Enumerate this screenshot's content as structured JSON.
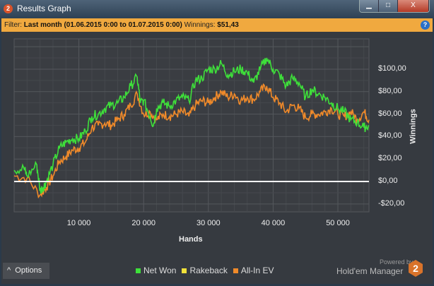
{
  "window": {
    "title": "Results Graph",
    "app_icon": "2",
    "minimize": "▁",
    "maximize": "□",
    "close": "X"
  },
  "filter": {
    "label": "Filter:",
    "value": "Last month (01.06.2015 0:00 to 01.07.2015 0:00)",
    "winnings_label": "Winnings:",
    "winnings_value": "$51,43",
    "help": "?"
  },
  "options_label": "Options",
  "options_chevron": "^",
  "branding": {
    "powered": "Powered by",
    "name": "Hold'em Manager",
    "logo": "2"
  },
  "colors": {
    "net_won": "#3ee03a",
    "rakeback": "#f2e23a",
    "all_in_ev": "#f08a2a"
  },
  "chart_data": {
    "type": "line",
    "xlabel": "Hands",
    "ylabel": "Winnings",
    "xlim": [
      0,
      54800
    ],
    "ylim": [
      -27,
      127
    ],
    "x_ticks": [
      {
        "v": 10000,
        "label": "10 000"
      },
      {
        "v": 20000,
        "label": "20 000"
      },
      {
        "v": 30000,
        "label": "30 000"
      },
      {
        "v": 40000,
        "label": "40 000"
      },
      {
        "v": 50000,
        "label": "50 000"
      }
    ],
    "y_ticks": [
      {
        "v": 100,
        "label": "$100,00"
      },
      {
        "v": 80,
        "label": "$80,00"
      },
      {
        "v": 60,
        "label": "$60,00"
      },
      {
        "v": 40,
        "label": "$40,00"
      },
      {
        "v": 20,
        "label": "$20,00"
      },
      {
        "v": 0,
        "label": "$0,00"
      },
      {
        "v": -20,
        "label": "-$20,00"
      }
    ],
    "legend": [
      "Net Won",
      "Rakeback",
      "All-In EV"
    ],
    "legend_placement": "bottom",
    "series": [
      {
        "name": "Net Won",
        "x": [
          0,
          1500,
          2000,
          3500,
          4000,
          4500,
          5000,
          6000,
          7000,
          8000,
          9000,
          10000,
          11000,
          12000,
          13000,
          14000,
          15000,
          16000,
          17000,
          18000,
          19000,
          19500,
          20000,
          21000,
          21500,
          22000,
          23000,
          24000,
          25000,
          26000,
          27000,
          28000,
          29000,
          30000,
          31000,
          32000,
          33000,
          34000,
          35000,
          36000,
          37000,
          38000,
          39000,
          40000,
          41000,
          42000,
          43000,
          44000,
          45000,
          46000,
          47000,
          48000,
          49000,
          50000,
          51000,
          52000,
          53000,
          54000,
          54800
        ],
        "y": [
          10,
          12,
          5,
          15,
          -8,
          -5,
          0,
          15,
          30,
          35,
          38,
          38,
          45,
          58,
          60,
          65,
          68,
          70,
          75,
          85,
          93,
          70,
          72,
          58,
          50,
          65,
          70,
          67,
          72,
          75,
          72,
          90,
          92,
          100,
          100,
          105,
          95,
          98,
          100,
          97,
          88,
          100,
          110,
          100,
          95,
          85,
          92,
          88,
          75,
          82,
          78,
          75,
          70,
          65,
          62,
          55,
          53,
          48,
          50
        ]
      },
      {
        "name": "Rakeback",
        "x": [
          0,
          54800
        ],
        "y": [
          0,
          0
        ]
      },
      {
        "name": "All-In EV",
        "x": [
          0,
          2000,
          4000,
          5000,
          6000,
          7000,
          8000,
          9000,
          10000,
          11000,
          12000,
          13000,
          14000,
          15000,
          16000,
          17000,
          18000,
          19000,
          20000,
          21000,
          22000,
          23000,
          24000,
          25000,
          26000,
          27000,
          28000,
          29000,
          30000,
          31000,
          32000,
          33000,
          34000,
          35000,
          36000,
          37000,
          38000,
          39000,
          40000,
          41000,
          42000,
          43000,
          44000,
          45000,
          46000,
          47000,
          48000,
          49000,
          50000,
          51000,
          52000,
          53000,
          54000,
          54800
        ],
        "y": [
          5,
          3,
          -12,
          -5,
          5,
          18,
          22,
          28,
          30,
          35,
          48,
          50,
          52,
          50,
          55,
          60,
          68,
          78,
          60,
          62,
          55,
          60,
          58,
          60,
          62,
          58,
          68,
          72,
          70,
          75,
          80,
          75,
          78,
          72,
          75,
          73,
          80,
          85,
          75,
          70,
          62,
          68,
          65,
          57,
          60,
          60,
          62,
          65,
          60,
          58,
          62,
          55,
          62,
          55
        ]
      }
    ]
  }
}
